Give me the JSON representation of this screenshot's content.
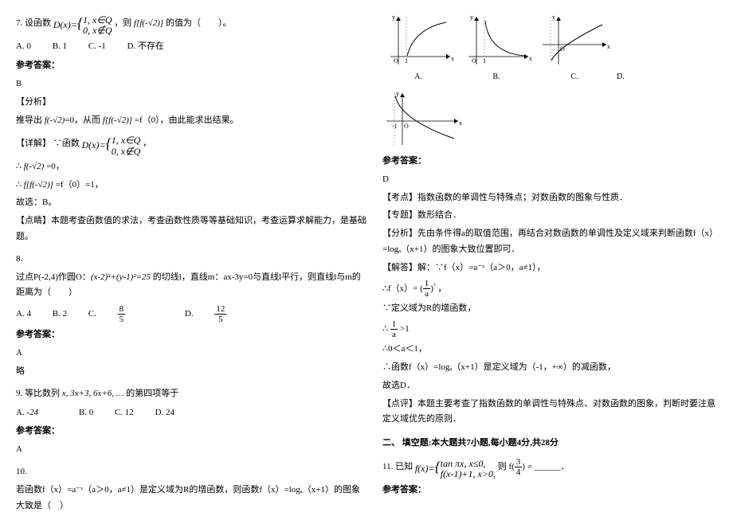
{
  "q7": {
    "num": "7.",
    "prefix": "设函数",
    "piecewise": "D(x) = {1, x∈Q; 0, x∉Q}",
    "tail": "则 f[f(-√2)] 的值为（　　）。",
    "opts": {
      "A": "A. 0",
      "B": "B. 1",
      "C": "C. -1",
      "D": "D. 不存在"
    },
    "ansLabel": "参考答案：",
    "ans": "B",
    "analysisLabel": "【分析】",
    "analysisLine": "推导出 f(-√2)=0，从而 f[f(-√2)] =f（0），由此能求出结果。",
    "detailLabel": "【详解】",
    "detailPrefix": "∵函数",
    "detailPiece": "D(x) = {1, x∈Q; 0, x∉Q}",
    "detailComma": "，",
    "step1": "∴ f(-√2) =0，",
    "step2pre": "∴",
    "step2formula": "f[f(-√2)]",
    "step2post": "=f（0）=1，",
    "choice": "故选：B。",
    "comment": "【点睛】本题考查函数值的求法，考查函数性质等等基础知识，考查运算求解能力，是基础题。"
  },
  "q8": {
    "num": "8.",
    "text": "过点P(-2,4)作圆O：(x-2)²+(y-1)²=25 的切线l，直线m：ax-3y=0与直线l平行，则直线l与m的距离为（　　）",
    "opts": {
      "A": "A. 4",
      "B": "B. 2",
      "C": "C. ",
      "D": "D. "
    },
    "fracC": {
      "num": "8",
      "den": "5"
    },
    "fracD": {
      "num": "12",
      "den": "5"
    },
    "ansLabel": "参考答案：",
    "ans": "A",
    "omit": "略"
  },
  "q9": {
    "num": "9.",
    "text": "等比数列 x, 3x+3, 6x+6, … 的第四项等于",
    "opts": {
      "A": "A. -24",
      "B": "B. 0",
      "C": "C. 12",
      "D": "D. 24"
    },
    "ansLabel": "参考答案：",
    "ans": "A"
  },
  "q10": {
    "num": "10.",
    "text": "若函数f（x）=a⁻ˣ（a＞0，a≠1）是定义域为R的增函数，则函数f（x）=logₐ（x+1）的图象大致是（　）",
    "optLabels": {
      "A": "A.",
      "B": "B.",
      "C": "C.",
      "D": "D."
    },
    "ansLabel": "参考答案：",
    "ans": "D",
    "kaodian": "【考点】指数函数的单调性与特殊点；对数函数的图象与性质．",
    "zhuanti": "【专题】数形结合．",
    "fenxi": "【分析】先由条件得a的取值范围，再结合对数函数的单调性及定义域来判断函数f（x）=logₐ（x+1）的图象大致位置即可．",
    "jiedaLabel": "【解答】",
    "jiedaLine1": "解：∵f（x）=a⁻ˣ（a＞0，a≠1），",
    "jiedaLine2a": "∴f（x）= ",
    "jiedaFrac": {
      "num": "1",
      "den": "a"
    },
    "jiedaLine2b": "ˣ",
    "jiedaLine2c": "，",
    "jiedaLine3": "∵定义域为R的增函数，",
    "jiedaLine4a": "∴",
    "jiedaFrac2": {
      "num": "1",
      "den": "a"
    },
    "jiedaLine4b": ">1",
    "jiedaLine5": "∴0＜a＜1，",
    "jiedaLine6": "∴函数f（x）=logₐ（x+1）是定义域为（-1，+∞）的减函数，",
    "jiedaLine7": "故选D．",
    "dianping": "【点评】本题主要考查了指数函数的单调性与特殊点、对数函数的图象，判断时要注意定义域优先的原则．"
  },
  "section2": "二、 填空题:本大题共7小题,每小题4分,共28分",
  "q11": {
    "num": "11.",
    "pre": "已知",
    "piecewise": "f(x)= {tanπx, x≤0; f(x-1)+1, x>0}",
    "mid": "则 f(",
    "frac": {
      "num": "3",
      "den": "4"
    },
    "tail": ") = ______．",
    "ansLabel": "参考答案："
  }
}
